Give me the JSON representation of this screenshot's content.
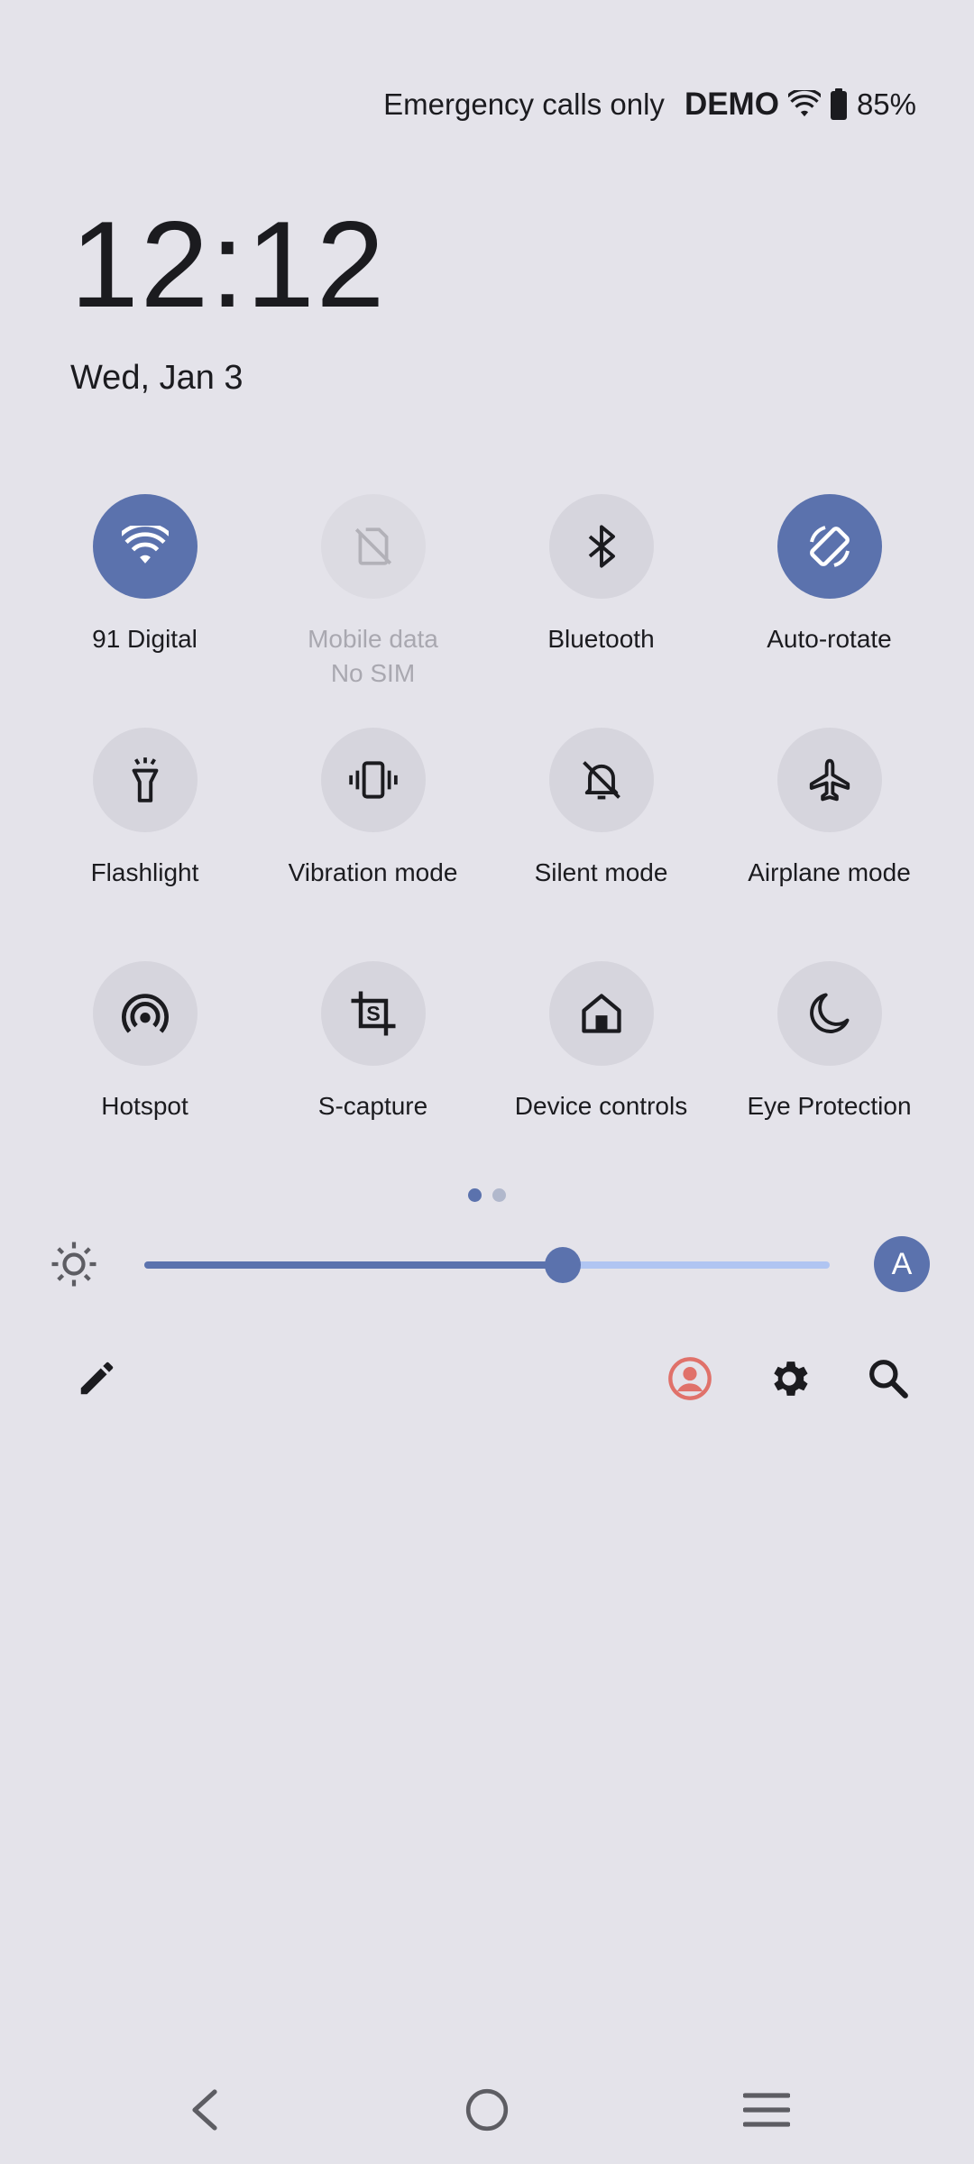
{
  "status_bar": {
    "carrier_text": "Emergency calls only",
    "demo_label": "DEMO",
    "wifi_icon": "wifi-icon",
    "battery_icon": "battery-icon",
    "battery_percent": "85%"
  },
  "clock": {
    "time": "12:12",
    "date": "Wed, Jan 3"
  },
  "tiles": [
    {
      "label": "91 Digital",
      "sublabel": "",
      "icon": "wifi-icon",
      "state": "on"
    },
    {
      "label": "Mobile data",
      "sublabel": "No SIM",
      "icon": "no-sim-icon",
      "state": "unavailable"
    },
    {
      "label": "Bluetooth",
      "sublabel": "",
      "icon": "bluetooth-icon",
      "state": "off"
    },
    {
      "label": "Auto-rotate",
      "sublabel": "",
      "icon": "auto-rotate-icon",
      "state": "on"
    },
    {
      "label": "Flashlight",
      "sublabel": "",
      "icon": "flashlight-icon",
      "state": "off"
    },
    {
      "label": "Vibration mode",
      "sublabel": "",
      "icon": "vibration-icon",
      "state": "off"
    },
    {
      "label": "Silent mode",
      "sublabel": "",
      "icon": "silent-bell-icon",
      "state": "off"
    },
    {
      "label": "Airplane mode",
      "sublabel": "",
      "icon": "airplane-icon",
      "state": "off"
    },
    {
      "label": "Hotspot",
      "sublabel": "",
      "icon": "hotspot-icon",
      "state": "off"
    },
    {
      "label": "S-capture",
      "sublabel": "",
      "icon": "s-capture-icon",
      "state": "off"
    },
    {
      "label": "Device controls",
      "sublabel": "",
      "icon": "home-icon",
      "state": "off"
    },
    {
      "label": "Eye Protection",
      "sublabel": "",
      "icon": "moon-icon",
      "state": "off"
    }
  ],
  "pages": {
    "current": 1,
    "total": 2
  },
  "brightness": {
    "level_percent": 61,
    "auto_label": "A",
    "icon": "brightness-sun-icon"
  },
  "actions": {
    "edit_icon": "pencil-icon",
    "user_icon": "user-account-icon",
    "settings_icon": "gear-icon",
    "search_icon": "search-icon"
  },
  "colors": {
    "background": "#e4e3ea",
    "accent": "#5b72ad",
    "tile_off": "#d6d5dd",
    "track_light": "#b0c5f2",
    "user_icon": "#e0716a"
  },
  "nav": {
    "back_icon": "back-icon",
    "home_icon": "home-circle-icon",
    "recents_icon": "recents-menu-icon"
  }
}
